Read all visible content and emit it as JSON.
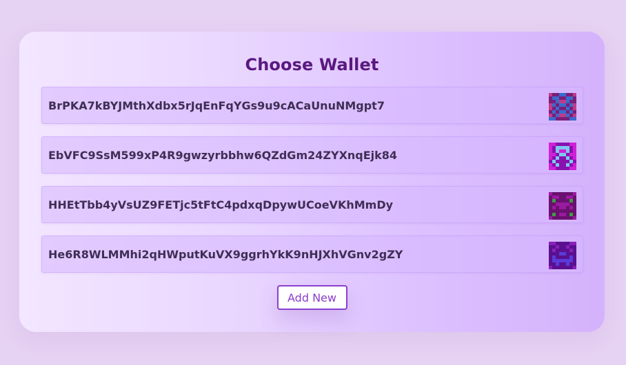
{
  "card": {
    "title": "Choose Wallet"
  },
  "wallets": [
    {
      "address": "BrPKA7kBYJMthXdbx5rJqEnFqYGs9u9cACaUnuNMgpt7",
      "avatar_icon": "pixel-avatar-icon",
      "avatar_colors": [
        "#c03a8a",
        "#7a1e7a",
        "#3a6ad0"
      ]
    },
    {
      "address": "EbVFC9SsM599xP4R9gwzyrbbhw6QZdGm24ZYXnqEjk84",
      "avatar_icon": "pixel-avatar-icon",
      "avatar_colors": [
        "#d020d8",
        "#8a10b0",
        "#7ec8f0"
      ]
    },
    {
      "address": "HHEtTbb4yVsUZ9FETjc5tFtC4pdxqDpywUCoeVKhMmDy",
      "avatar_icon": "pixel-avatar-icon",
      "avatar_colors": [
        "#9a1aa0",
        "#6a1070",
        "#3aa040"
      ]
    },
    {
      "address": "He6R8WLMMhi2qHWputKuVX9ggrhYkK9nHJXhVGnv2gZY",
      "avatar_icon": "pixel-avatar-icon",
      "avatar_colors": [
        "#8a20b8",
        "#5a1090",
        "#5a3ad8"
      ]
    }
  ],
  "actions": {
    "add_new_label": "Add New"
  }
}
